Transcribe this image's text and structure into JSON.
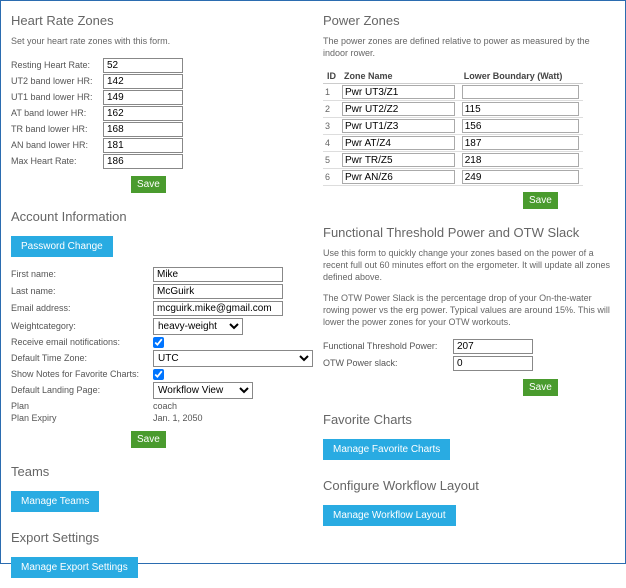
{
  "hr": {
    "title": "Heart Rate Zones",
    "desc": "Set your heart rate zones with this form.",
    "rows": [
      {
        "label": "Resting Heart Rate:",
        "value": "52"
      },
      {
        "label": "UT2 band lower HR:",
        "value": "142"
      },
      {
        "label": "UT1 band lower HR:",
        "value": "149"
      },
      {
        "label": "AT band lower HR:",
        "value": "162"
      },
      {
        "label": "TR band lower HR:",
        "value": "168"
      },
      {
        "label": "AN band lower HR:",
        "value": "181"
      },
      {
        "label": "Max Heart Rate:",
        "value": "186"
      }
    ],
    "save": "Save"
  },
  "account": {
    "title": "Account Information",
    "password_btn": "Password Change",
    "first_label": "First name:",
    "first_val": "Mike",
    "last_label": "Last name:",
    "last_val": "McGuirk",
    "email_label": "Email address:",
    "email_val": "mcguirk.mike@gmail.com",
    "weight_label": "Weightcategory:",
    "weight_val": "heavy-weight",
    "recv_label": "Receive email notifications:",
    "tz_label": "Default Time Zone:",
    "tz_val": "UTC",
    "notes_label": "Show Notes for Favorite Charts:",
    "landing_label": "Default Landing Page:",
    "landing_val": "Workflow View",
    "plan_label": "Plan",
    "plan_val": "coach",
    "expiry_label": "Plan Expiry",
    "expiry_val": "Jan. 1, 2050",
    "save": "Save"
  },
  "teams": {
    "title": "Teams",
    "btn": "Manage Teams"
  },
  "export": {
    "title": "Export Settings",
    "btn": "Manage Export Settings"
  },
  "pz": {
    "title": "Power Zones",
    "desc": "The power zones are defined relative to power as measured by the indoor rower.",
    "th_id": "ID",
    "th_name": "Zone Name",
    "th_lb": "Lower Boundary (Watt)",
    "rows": [
      {
        "id": "1",
        "name": "Pwr UT3/Z1",
        "lb": ""
      },
      {
        "id": "2",
        "name": "Pwr UT2/Z2",
        "lb": "115"
      },
      {
        "id": "3",
        "name": "Pwr UT1/Z3",
        "lb": "156"
      },
      {
        "id": "4",
        "name": "Pwr AT/Z4",
        "lb": "187"
      },
      {
        "id": "5",
        "name": "Pwr TR/Z5",
        "lb": "218"
      },
      {
        "id": "6",
        "name": "Pwr AN/Z6",
        "lb": "249"
      }
    ],
    "save": "Save"
  },
  "ftp": {
    "title": "Functional Threshold Power and OTW Slack",
    "desc1": "Use this form to quickly change your zones based on the power of a recent full out 60 minutes effort on the ergometer. It will update all zones defined above.",
    "desc2": "The OTW Power Slack is the percentage drop of your On-the-water rowing power vs the erg power. Typical values are around 15%. This will lower the power zones for your OTW workouts.",
    "ftp_label": "Functional Threshold Power:",
    "ftp_val": "207",
    "slack_label": "OTW Power slack:",
    "slack_val": "0",
    "save": "Save"
  },
  "fav": {
    "title": "Favorite Charts",
    "btn": "Manage Favorite Charts"
  },
  "wf": {
    "title": "Configure Workflow Layout",
    "btn": "Manage Workflow Layout"
  }
}
